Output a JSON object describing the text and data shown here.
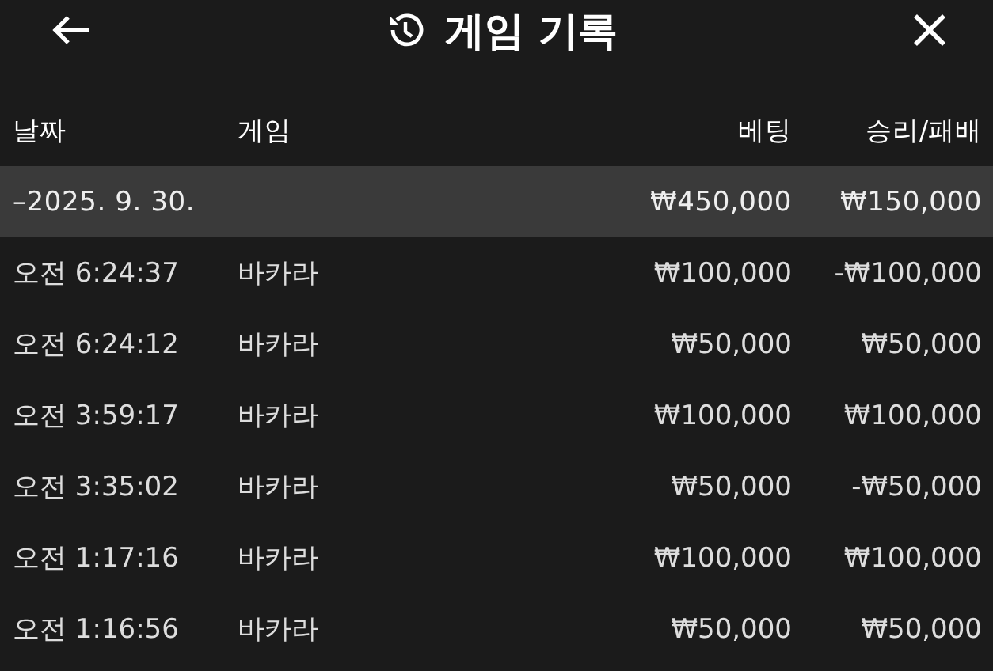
{
  "header": {
    "title": "게임 기록"
  },
  "columns": [
    "날짜",
    "게임",
    "베팅",
    "승리/패배"
  ],
  "group": {
    "date": "–2025. 9. 30.",
    "bet": "₩450,000",
    "result": "₩150,000"
  },
  "rows": [
    {
      "time": "오전 6:24:37",
      "game": "바카라",
      "bet": "₩100,000",
      "result": "-₩100,000"
    },
    {
      "time": "오전 6:24:12",
      "game": "바카라",
      "bet": "₩50,000",
      "result": "₩50,000"
    },
    {
      "time": "오전 3:59:17",
      "game": "바카라",
      "bet": "₩100,000",
      "result": "₩100,000"
    },
    {
      "time": "오전 3:35:02",
      "game": "바카라",
      "bet": "₩50,000",
      "result": "-₩50,000"
    },
    {
      "time": "오전 1:17:16",
      "game": "바카라",
      "bet": "₩100,000",
      "result": "₩100,000"
    },
    {
      "time": "오전 1:16:56",
      "game": "바카라",
      "bet": "₩50,000",
      "result": "₩50,000"
    }
  ]
}
